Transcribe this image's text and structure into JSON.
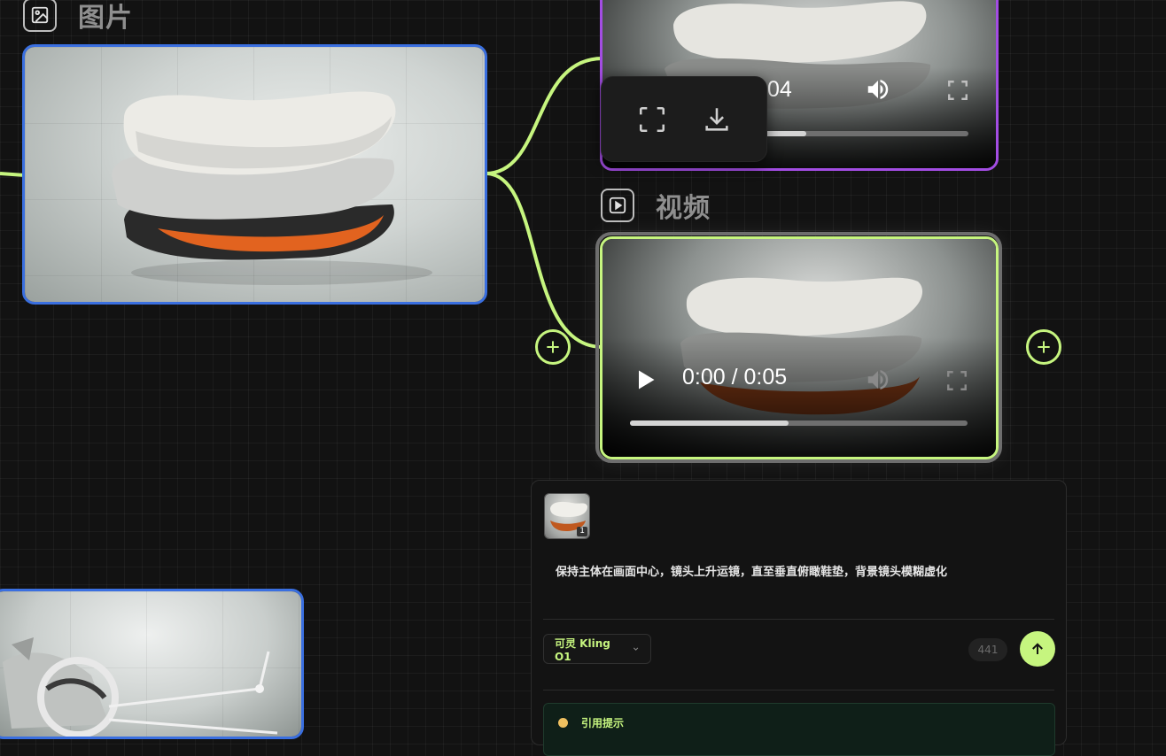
{
  "image_node": {
    "title": "图片",
    "icon": "image-icon"
  },
  "video_node": {
    "title": "视频",
    "icon": "play-square-icon"
  },
  "top_video": {
    "time_fragment": "04",
    "progress": 0.52
  },
  "main_video": {
    "time": "0:00 / 0:05",
    "progress": 0.47
  },
  "popup_toolbar": {
    "items": [
      "fullscreen-icon",
      "download-icon"
    ]
  },
  "prompt_panel": {
    "thumbnail_badge": "1",
    "prompt": "保持主体在画面中心，镜头上升运镜，直至垂直俯瞰鞋垫，背景镜头模糊虚化",
    "model": "可灵 Kling O1",
    "count": "441",
    "hint_title": "引用提示"
  },
  "colors": {
    "accent": "#c6f57f",
    "image_border": "#3a6fe0",
    "video_top_border": "#a34de3",
    "background": "#121212"
  }
}
